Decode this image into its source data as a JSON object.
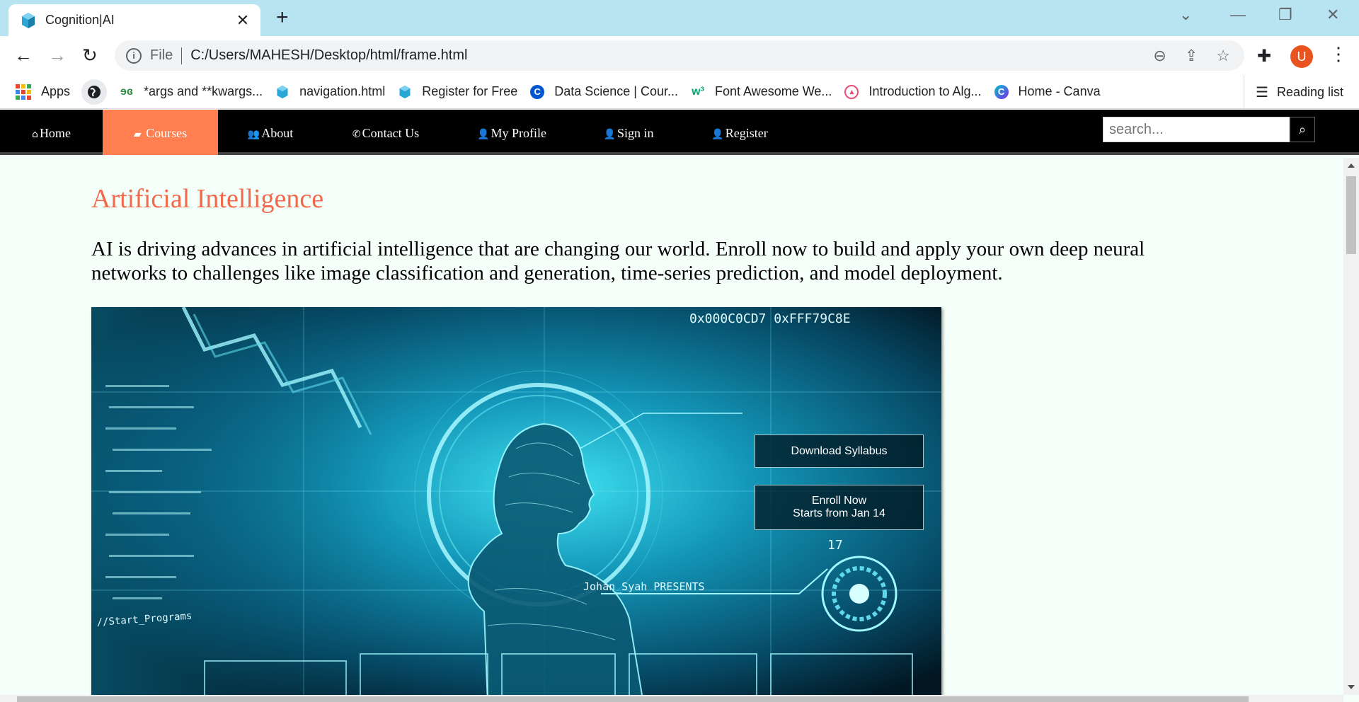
{
  "browser": {
    "tab_title": "Cognition|AI",
    "file_label": "File",
    "url": "C:/Users/MAHESH/Desktop/html/frame.html",
    "avatar_letter": "U",
    "bookmarks": [
      {
        "label": "Apps",
        "icon": "apps-grid-icon"
      },
      {
        "label": "*args and **kwargs...",
        "icon": "geeksforgeeks-icon",
        "color": "#2f8d46"
      },
      {
        "label": "navigation.html",
        "icon": "document-icon",
        "color": "#2196c9"
      },
      {
        "label": "Register for Free",
        "icon": "document-icon",
        "color": "#2196c9"
      },
      {
        "label": "Data Science | Cour...",
        "icon": "coursera-icon",
        "color": "#0056d2"
      },
      {
        "label": "Font Awesome We...",
        "icon": "w3schools-icon",
        "color": "#04aa6d"
      },
      {
        "label": "Introduction to Alg...",
        "icon": "course-icon",
        "color": "#e94e77"
      },
      {
        "label": "Home - Canva",
        "icon": "canva-icon",
        "color": "#7d2ae8"
      }
    ],
    "reading_list": "Reading list"
  },
  "site": {
    "nav": [
      {
        "label": "Home",
        "icon": "home-icon",
        "glyph": "⌂"
      },
      {
        "label": " Courses",
        "icon": "book-icon",
        "glyph": "▰"
      },
      {
        "label": "About",
        "icon": "users-icon",
        "glyph": "👥"
      },
      {
        "label": "Contact Us",
        "icon": "phone-icon",
        "glyph": "✆"
      },
      {
        "label": "My Profile",
        "icon": "user-icon",
        "glyph": "👤"
      },
      {
        "label": "Sign in",
        "icon": "user-plus-icon",
        "glyph": "👤"
      },
      {
        "label": "Register",
        "icon": "user-icon",
        "glyph": "👤"
      }
    ],
    "search_placeholder": "search...",
    "colors": {
      "accent": "#ff7f50",
      "heading": "#f26a4b",
      "page_bg": "#f5fffa",
      "nav_bg": "#000000"
    }
  },
  "main": {
    "heading": "Artificial Intelligence",
    "description": "AI is driving advances in artificial intelligence that are changing our world. Enroll now to build and apply your own deep neural networks to challenges like image classification and generation, time-series prediction, and model deployment.",
    "hero_texts": {
      "hex_code": "0x000C0CD7 0xFFF79C8E",
      "presents": "Johan_Syah PRESENTS",
      "start_programs": "//Start_Programs",
      "counter": "17"
    },
    "download_button": "Download Syllabus",
    "enroll_button_line1": "Enroll Now",
    "enroll_button_line2": "Starts from Jan 14"
  }
}
